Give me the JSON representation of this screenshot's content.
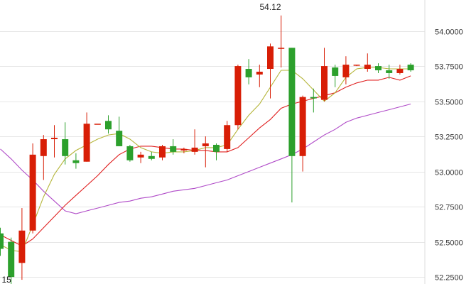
{
  "chart_data": {
    "type": "candlestick",
    "y_axis": {
      "min": 52.2,
      "max": 54.22,
      "ticks": [
        52.25,
        52.5,
        52.75,
        53.0,
        53.25,
        53.5,
        53.75,
        54.0
      ],
      "tick_labels": [
        "52.2500",
        "52.5000",
        "52.7500",
        "53.0000",
        "53.2500",
        "53.5000",
        "53.7500",
        "54.0000"
      ],
      "position": "right",
      "grid": true
    },
    "annotations": [
      {
        "text": "54.12",
        "candle_index": 25,
        "value": 54.12
      },
      {
        "text": "15",
        "candle_index": 0,
        "value": 52.19
      }
    ],
    "colors": {
      "up": "#d81e06",
      "down": "#2ca02c",
      "ma_short": "#b5b53a",
      "ma_mid": "#e02020",
      "ma_long": "#b04bc8",
      "grid": "#e6e6e6"
    },
    "candles": [
      {
        "o": 52.56,
        "h": 52.6,
        "l": 52.4,
        "c": 52.45
      },
      {
        "o": 52.5,
        "h": 52.53,
        "l": 52.18,
        "c": 52.25
      },
      {
        "o": 52.35,
        "h": 52.74,
        "l": 52.23,
        "c": 52.58
      },
      {
        "o": 52.58,
        "h": 53.2,
        "l": 52.56,
        "c": 53.12
      },
      {
        "o": 53.11,
        "h": 53.26,
        "l": 52.94,
        "c": 53.23
      },
      {
        "o": 53.23,
        "h": 53.33,
        "l": 53.1,
        "c": 53.24
      },
      {
        "o": 53.23,
        "h": 53.35,
        "l": 53.05,
        "c": 53.11
      },
      {
        "o": 53.08,
        "h": 53.13,
        "l": 53.02,
        "c": 53.06
      },
      {
        "o": 53.07,
        "h": 53.42,
        "l": 53.07,
        "c": 53.34
      },
      {
        "o": 53.34,
        "h": 53.34,
        "l": 53.34,
        "c": 53.34
      },
      {
        "o": 53.36,
        "h": 53.4,
        "l": 53.27,
        "c": 53.3
      },
      {
        "o": 53.29,
        "h": 53.39,
        "l": 53.18,
        "c": 53.18
      },
      {
        "o": 53.18,
        "h": 53.19,
        "l": 53.07,
        "c": 53.08
      },
      {
        "o": 53.1,
        "h": 53.14,
        "l": 53.06,
        "c": 53.12
      },
      {
        "o": 53.11,
        "h": 53.14,
        "l": 53.08,
        "c": 53.09
      },
      {
        "o": 53.1,
        "h": 53.19,
        "l": 53.08,
        "c": 53.18
      },
      {
        "o": 53.18,
        "h": 53.23,
        "l": 53.12,
        "c": 53.14
      },
      {
        "o": 53.15,
        "h": 53.17,
        "l": 53.13,
        "c": 53.16
      },
      {
        "o": 53.14,
        "h": 53.3,
        "l": 53.12,
        "c": 53.17
      },
      {
        "o": 53.18,
        "h": 53.25,
        "l": 53.03,
        "c": 53.2
      },
      {
        "o": 53.19,
        "h": 53.2,
        "l": 53.08,
        "c": 53.14
      },
      {
        "o": 53.16,
        "h": 53.36,
        "l": 53.14,
        "c": 53.33
      },
      {
        "o": 53.33,
        "h": 53.76,
        "l": 53.3,
        "c": 53.75
      },
      {
        "o": 53.73,
        "h": 53.8,
        "l": 53.62,
        "c": 53.67
      },
      {
        "o": 53.69,
        "h": 53.76,
        "l": 53.6,
        "c": 53.71
      },
      {
        "o": 53.73,
        "h": 53.91,
        "l": 53.52,
        "c": 53.89
      },
      {
        "o": 53.88,
        "h": 54.11,
        "l": 53.74,
        "c": 53.88
      },
      {
        "o": 53.88,
        "h": 53.88,
        "l": 52.78,
        "c": 53.11
      },
      {
        "o": 53.11,
        "h": 53.54,
        "l": 53.0,
        "c": 53.53
      },
      {
        "o": 53.53,
        "h": 53.59,
        "l": 53.42,
        "c": 53.52
      },
      {
        "o": 53.51,
        "h": 53.88,
        "l": 53.5,
        "c": 53.75
      },
      {
        "o": 53.74,
        "h": 53.76,
        "l": 53.6,
        "c": 53.68
      },
      {
        "o": 53.67,
        "h": 53.82,
        "l": 53.62,
        "c": 53.76
      },
      {
        "o": 53.76,
        "h": 53.76,
        "l": 53.75,
        "c": 53.76
      },
      {
        "o": 53.73,
        "h": 53.84,
        "l": 53.71,
        "c": 53.76
      },
      {
        "o": 53.75,
        "h": 53.77,
        "l": 53.7,
        "c": 53.72
      },
      {
        "o": 53.72,
        "h": 53.76,
        "l": 53.66,
        "c": 53.7
      },
      {
        "o": 53.7,
        "h": 53.76,
        "l": 53.69,
        "c": 53.73
      },
      {
        "o": 53.76,
        "h": 53.77,
        "l": 53.71,
        "c": 53.72
      }
    ],
    "ma_short": [
      52.48,
      52.44,
      52.43,
      52.62,
      52.82,
      52.98,
      53.09,
      53.15,
      53.19,
      53.23,
      53.26,
      53.27,
      53.23,
      53.17,
      53.14,
      53.13,
      53.14,
      53.14,
      53.15,
      53.17,
      53.17,
      53.19,
      53.3,
      53.4,
      53.48,
      53.6,
      53.72,
      53.72,
      53.66,
      53.58,
      53.5,
      53.56,
      53.67,
      53.73,
      53.74,
      53.74,
      53.73,
      53.73,
      53.73
    ],
    "ma_mid": [
      52.55,
      52.51,
      52.47,
      52.52,
      52.6,
      52.68,
      52.76,
      52.83,
      52.9,
      52.97,
      53.05,
      53.12,
      53.16,
      53.18,
      53.18,
      53.17,
      53.16,
      53.16,
      53.15,
      53.15,
      53.14,
      53.14,
      53.17,
      53.24,
      53.31,
      53.37,
      53.45,
      53.48,
      53.5,
      53.52,
      53.54,
      53.56,
      53.6,
      53.63,
      53.65,
      53.65,
      53.67,
      53.65,
      53.68
    ],
    "ma_long": [
      53.16,
      53.09,
      53.01,
      52.94,
      52.86,
      52.79,
      52.72,
      52.7,
      52.72,
      52.74,
      52.76,
      52.78,
      52.79,
      52.81,
      52.82,
      52.84,
      52.86,
      52.87,
      52.88,
      52.9,
      52.92,
      52.94,
      52.97,
      53.0,
      53.03,
      53.06,
      53.09,
      53.12,
      53.16,
      53.21,
      53.26,
      53.3,
      53.35,
      53.38,
      53.4,
      53.42,
      53.44,
      53.46,
      53.48
    ]
  }
}
